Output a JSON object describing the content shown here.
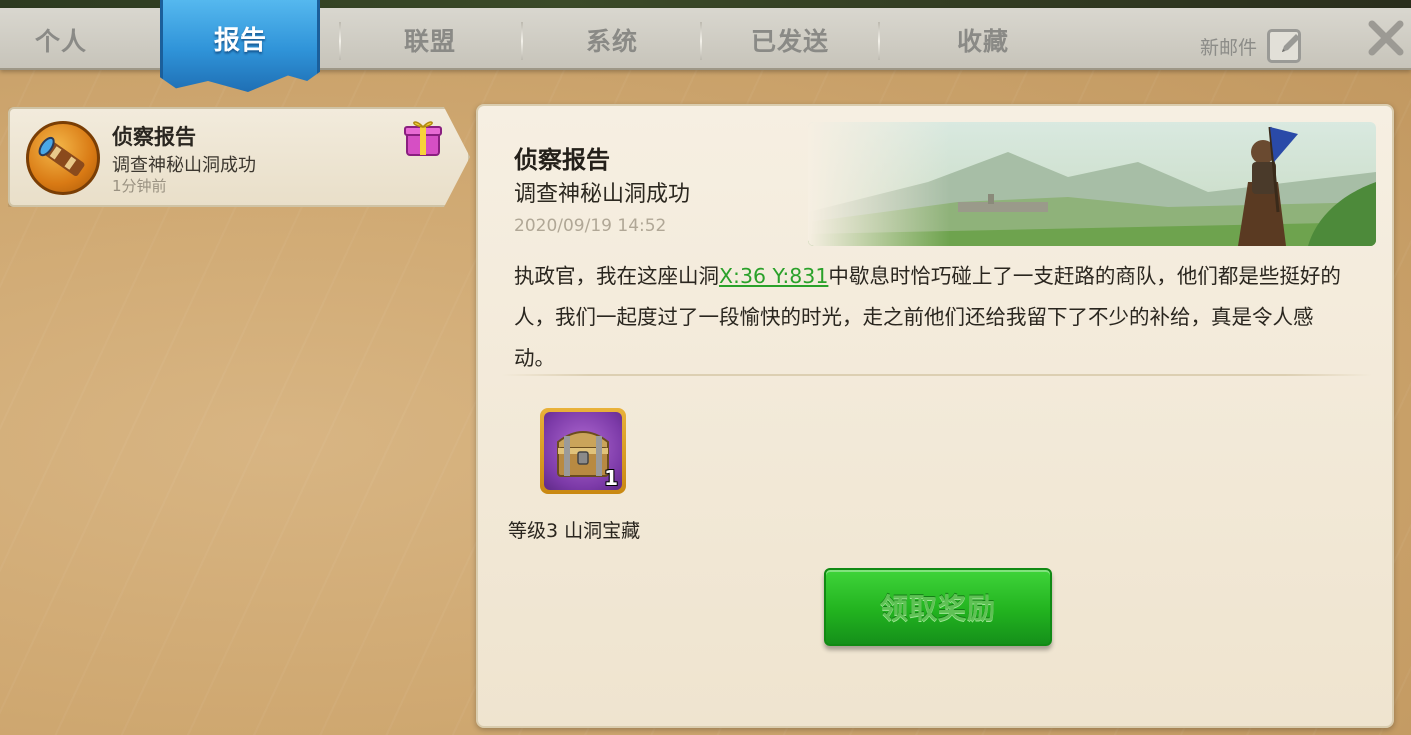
{
  "tabs": {
    "personal": "个人",
    "report": "报告",
    "alliance": "联盟",
    "system": "系统",
    "sent": "已发送",
    "favorites": "收藏",
    "active": "report"
  },
  "header": {
    "new_mail_label": "新邮件"
  },
  "mail_list": [
    {
      "title": "侦察报告",
      "subtitle": "调查神秘山洞成功",
      "time": "1分钟前",
      "icon": "spyglass-icon",
      "badge_icon": "gift-icon"
    }
  ],
  "detail": {
    "title": "侦察报告",
    "subtitle": "调查神秘山洞成功",
    "date": "2020/09/19 14:52",
    "body_before": "执政官，我在这座山洞",
    "coord_link": "X:36 Y:831",
    "body_after": "中歇息时恰巧碰上了一支赶路的商队，他们都是些挺好的人，我们一起度过了一段愉快的时光，走之前他们还给我留下了不少的补给，真是令人感动。",
    "reward": {
      "icon": "treasure-chest-icon",
      "count": "1",
      "label": "等级3 山洞宝藏"
    },
    "claim_button": "领取奖励"
  },
  "colors": {
    "active_tab": "#2f93d8",
    "link_green": "#2aa12a",
    "button_green": "#22b31f"
  }
}
